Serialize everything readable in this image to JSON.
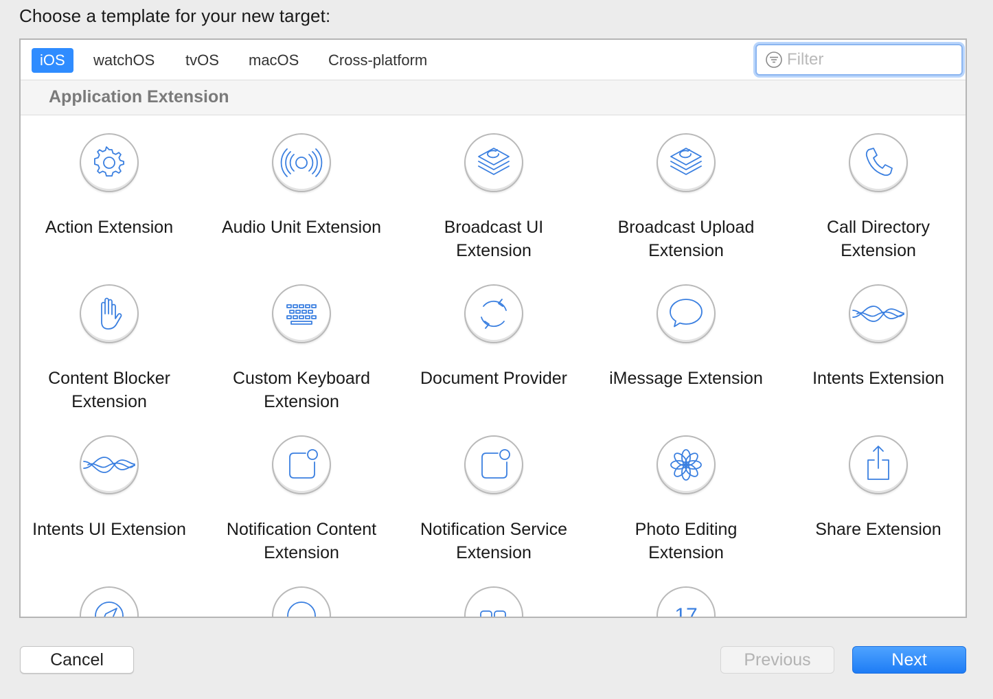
{
  "window": {
    "heading": "Choose a template for your new target:"
  },
  "platform_tabs": [
    {
      "label": "iOS",
      "selected": true
    },
    {
      "label": "watchOS",
      "selected": false
    },
    {
      "label": "tvOS",
      "selected": false
    },
    {
      "label": "macOS",
      "selected": false
    },
    {
      "label": "Cross-platform",
      "selected": false
    }
  ],
  "filter": {
    "placeholder": "Filter",
    "value": ""
  },
  "section": {
    "title": "Application Extension"
  },
  "templates": [
    {
      "label": "Action Extension",
      "icon": "gear-icon"
    },
    {
      "label": "Audio Unit Extension",
      "icon": "sound-waves-icon"
    },
    {
      "label": "Broadcast UI Extension",
      "icon": "broadcast-stack-icon"
    },
    {
      "label": "Broadcast Upload Extension",
      "icon": "broadcast-stack-icon"
    },
    {
      "label": "Call Directory Extension",
      "icon": "phone-icon"
    },
    {
      "label": "Content Blocker Extension",
      "icon": "hand-icon"
    },
    {
      "label": "Custom Keyboard Extension",
      "icon": "keyboard-icon"
    },
    {
      "label": "Document Provider",
      "icon": "sync-arrows-icon"
    },
    {
      "label": "iMessage Extension",
      "icon": "speech-bubble-icon"
    },
    {
      "label": "Intents Extension",
      "icon": "siri-waves-icon"
    },
    {
      "label": "Intents UI Extension",
      "icon": "siri-waves-icon"
    },
    {
      "label": "Notification Content Extension",
      "icon": "notification-badge-icon"
    },
    {
      "label": "Notification Service Extension",
      "icon": "notification-badge-icon"
    },
    {
      "label": "Photo Editing Extension",
      "icon": "photos-flower-icon"
    },
    {
      "label": "Share Extension",
      "icon": "share-icon"
    },
    {
      "label": "",
      "icon": "safari-compass-icon"
    },
    {
      "label": "",
      "icon": "circle-icon"
    },
    {
      "label": "",
      "icon": "split-view-icon"
    },
    {
      "label": "17",
      "icon": "calendar-icon"
    }
  ],
  "buttons": {
    "cancel": "Cancel",
    "previous": "Previous",
    "next": "Next"
  },
  "colors": {
    "accent": "#2f8cff",
    "icon_stroke": "#3a7fe0",
    "section_text": "#7a7a7a"
  }
}
